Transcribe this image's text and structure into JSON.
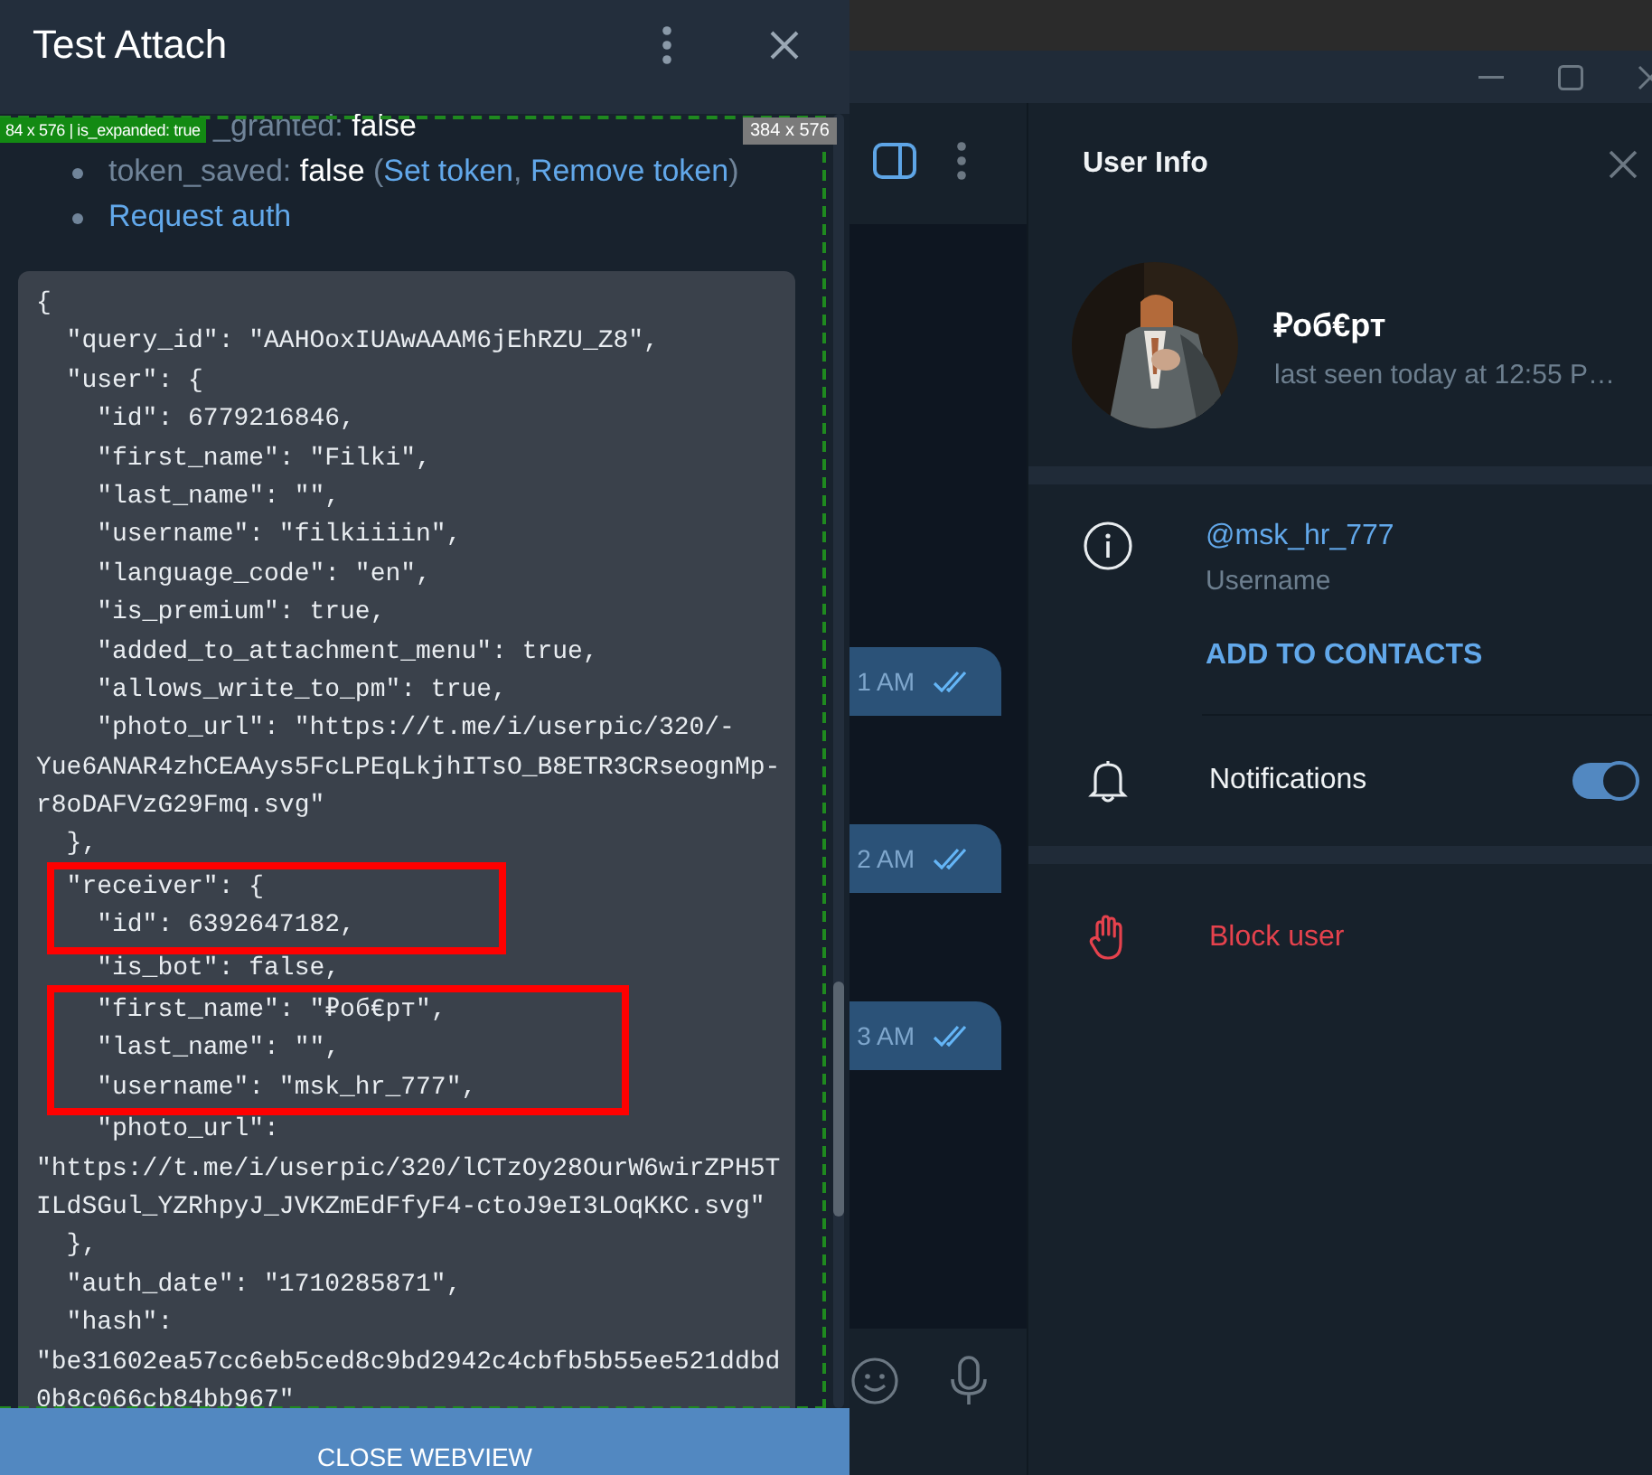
{
  "webview": {
    "title": "Test Attach",
    "debug_badge": "84 x 576 | is_expanded: true",
    "size_badge": "384 x 576",
    "status_items": [
      {
        "parts": [
          {
            "kind": "label",
            "text": "_granted: "
          },
          {
            "kind": "value",
            "text": "false"
          }
        ]
      },
      {
        "parts": [
          {
            "kind": "label",
            "text": "token_saved: "
          },
          {
            "kind": "value",
            "text": "false"
          },
          {
            "kind": "label",
            "text": " ("
          },
          {
            "kind": "link",
            "text": "Set token"
          },
          {
            "kind": "label",
            "text": ", "
          },
          {
            "kind": "link",
            "text": "Remove token"
          },
          {
            "kind": "label",
            "text": ")"
          }
        ]
      },
      {
        "parts": [
          {
            "kind": "link",
            "text": "Request auth"
          }
        ]
      }
    ],
    "code_blocks": [
      {
        "highlighted": false,
        "lines": [
          "{",
          "  \"query_id\": \"AAHOoxIUAwAAAM6jEhRZU_Z8\",",
          "  \"user\": {",
          "    \"id\": 6779216846,",
          "    \"first_name\": \"Filki\",",
          "    \"last_name\": \"\",",
          "    \"username\": \"filkiiiin\",",
          "    \"language_code\": \"en\",",
          "    \"is_premium\": true,",
          "    \"added_to_attachment_menu\": true,",
          "    \"allows_write_to_pm\": true,",
          "    \"photo_url\": \"https://t.me/i/userpic/320/-",
          "Yue6ANAR4zhCEAAys5FcLPEqLkjhITsO_B8ETR3CRseognMp-",
          "r8oDAFVzG29Fmq.svg\"",
          "  },"
        ]
      },
      {
        "highlighted": true,
        "lines": [
          "  \"receiver\": {",
          "    \"id\": 6392647182,"
        ]
      },
      {
        "highlighted": false,
        "lines": [
          "    \"is_bot\": false,"
        ]
      },
      {
        "highlighted": true,
        "lines": [
          "    \"first_name\": \"₽об€рт\",",
          "    \"last_name\": \"\",",
          "    \"username\": \"msk_hr_777\","
        ]
      },
      {
        "highlighted": false,
        "lines": [
          "    \"photo_url\":",
          "\"https://t.me/i/userpic/320/lCTzOy28OurW6wirZPH5T",
          "ILdSGul_YZRhpyJ_JVKZmEdFfyF4-ctoJ9eI3LOqKKC.svg\"",
          "  },",
          "  \"auth_date\": \"1710285871\",",
          "  \"hash\":",
          "\"be31602ea57cc6eb5ced8c9bd2942c4cbfb5b55ee521ddbd",
          "0b8c066cb84bb967\""
        ]
      }
    ],
    "close_button": "CLOSE WEBVIEW"
  },
  "chat": {
    "bubbles": [
      {
        "time": "1 AM",
        "read": true
      },
      {
        "time": "2 AM",
        "read": true
      },
      {
        "time": "3 AM",
        "read": true
      }
    ]
  },
  "user_info": {
    "title": "User Info",
    "name": "₽об€рт",
    "status": "last seen today at 12:55 P…",
    "username": "@msk_hr_777",
    "username_label": "Username",
    "add_contact": "ADD TO CONTACTS",
    "notifications": {
      "label": "Notifications",
      "on": true
    },
    "block": "Block user"
  }
}
